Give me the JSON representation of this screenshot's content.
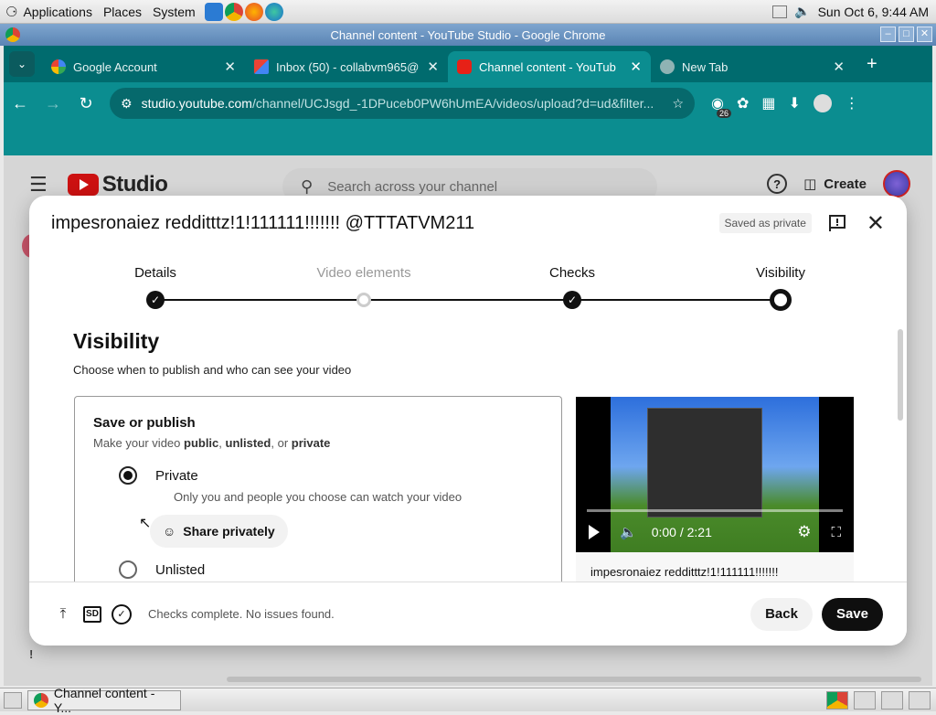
{
  "top_panel": {
    "menus": [
      "Applications",
      "Places",
      "System"
    ],
    "clock": "Sun Oct  6,  9:44 AM"
  },
  "window": {
    "title": "Channel content - YouTube Studio - Google Chrome"
  },
  "tabs": [
    {
      "label": "Google Account",
      "active": false
    },
    {
      "label": "Inbox (50) - collabvm965@",
      "active": false
    },
    {
      "label": "Channel content - YouTub",
      "active": true
    },
    {
      "label": "New Tab",
      "active": false
    }
  ],
  "address_bar": {
    "host": "studio.youtube.com",
    "path": "/channel/UCJsgd_-1DPuceb0PW6hUmEA/videos/upload?d=ud&filter..."
  },
  "extension_badge": "26",
  "studio": {
    "logo_text": "Studio",
    "search_placeholder": "Search across your channel",
    "create_label": "Create"
  },
  "modal": {
    "title": "impesronaiez redditttz!1!111111!!!!!!! @TTTATVM211",
    "saved_badge": "Saved as private",
    "steps": [
      {
        "label": "Details",
        "state": "done"
      },
      {
        "label": "Video elements",
        "state": "disabled"
      },
      {
        "label": "Checks",
        "state": "done"
      },
      {
        "label": "Visibility",
        "state": "current"
      }
    ],
    "heading": "Visibility",
    "subheading": "Choose when to publish and who can see your video",
    "publish": {
      "title": "Save or publish",
      "desc_prefix": "Make your video ",
      "opt_public": "public",
      "sep1": ", ",
      "opt_unlisted": "unlisted",
      "sep2": ", or ",
      "opt_private": "private",
      "private_label": "Private",
      "private_help": "Only you and people you choose can watch your video",
      "share_label": "Share privately",
      "unlisted_label": "Unlisted"
    },
    "preview": {
      "time": "0:00 / 2:21",
      "caption": "impesronaiez redditttz!1!111111!!!!!!!"
    },
    "footer": {
      "status": "Checks complete. No issues found.",
      "sd_label": "SD",
      "back_label": "Back",
      "save_label": "Save"
    }
  },
  "taskbar": {
    "item_label": "Channel content - Y..."
  }
}
